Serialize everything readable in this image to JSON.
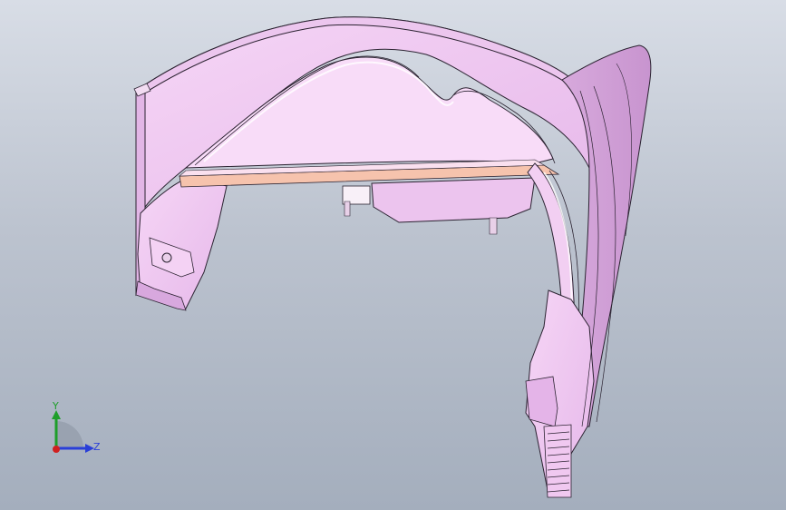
{
  "viewport": {
    "background_top": "#d8dde6",
    "background_bottom": "#a4aebd"
  },
  "model": {
    "part_color": "#f2cdf2",
    "part_shade_color": "#dcaee0",
    "edge_color": "#2a2230",
    "accent_strip_color": "#f6c3ad"
  },
  "triad": {
    "y_label": "Y",
    "z_label": "Z",
    "y_color": "#1e9e2a",
    "z_color": "#2a3fd8",
    "x_color": "#d02020"
  }
}
